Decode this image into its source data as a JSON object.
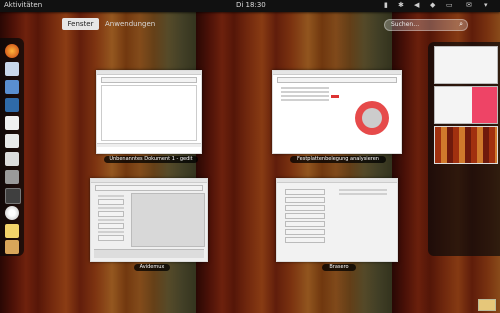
{
  "topbar": {
    "activities": "Aktivitäten",
    "clock": "Di 18:30"
  },
  "tabs": {
    "windows": "Fenster",
    "apps": "Anwendungen"
  },
  "search": {
    "placeholder": "Suchen…"
  },
  "windows": [
    {
      "title": "Unbenanntes Dokument 1 - gedit"
    },
    {
      "title": "Festplattenbelegung analysieren"
    },
    {
      "title": "Avidemux"
    },
    {
      "title": "Brasero"
    }
  ],
  "dash_icons": [
    "firefox-icon",
    "evolution-icon",
    "empathy-icon",
    "rhythmbox-icon",
    "writer-icon",
    "calc-icon",
    "impress-icon",
    "shotwell-icon",
    "software-center-icon",
    "help-icon",
    "notes-icon",
    "folder-icon"
  ],
  "colors": {
    "accent": "#e64a4a",
    "panel": "#111111"
  }
}
